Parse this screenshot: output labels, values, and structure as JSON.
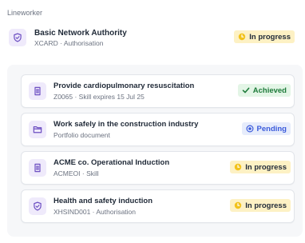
{
  "role": "Lineworker",
  "top": {
    "title": "Basic Network Authority",
    "subtitle": "XCARD · Authorisation",
    "status": "In progress",
    "icon": "shield-check-icon"
  },
  "items": [
    {
      "title": "Provide cardiopulmonary resuscitation",
      "subtitle": "Z0065 · Skill expires 15 Jul 25",
      "status": "Achieved",
      "icon": "document-icon"
    },
    {
      "title": "Work safely in the construction industry",
      "subtitle": "Portfolio document",
      "status": "Pending",
      "icon": "folder-icon"
    },
    {
      "title": "ACME co. Operational Induction",
      "subtitle": "ACMEOI · Skill",
      "status": "In progress",
      "icon": "document-icon"
    },
    {
      "title": "Health and safety induction",
      "subtitle": "XHSIND001 · Authorisation",
      "status": "In progress",
      "icon": "shield-check-icon"
    }
  ],
  "colors": {
    "accent": "#6d4fc2",
    "in_progress_bg": "#fdf1c4",
    "achieved_bg": "#e3f5e6",
    "achieved_text": "#1e7b3a",
    "pending_bg": "#e6ecfb",
    "pending_text": "#3b5bdb"
  }
}
